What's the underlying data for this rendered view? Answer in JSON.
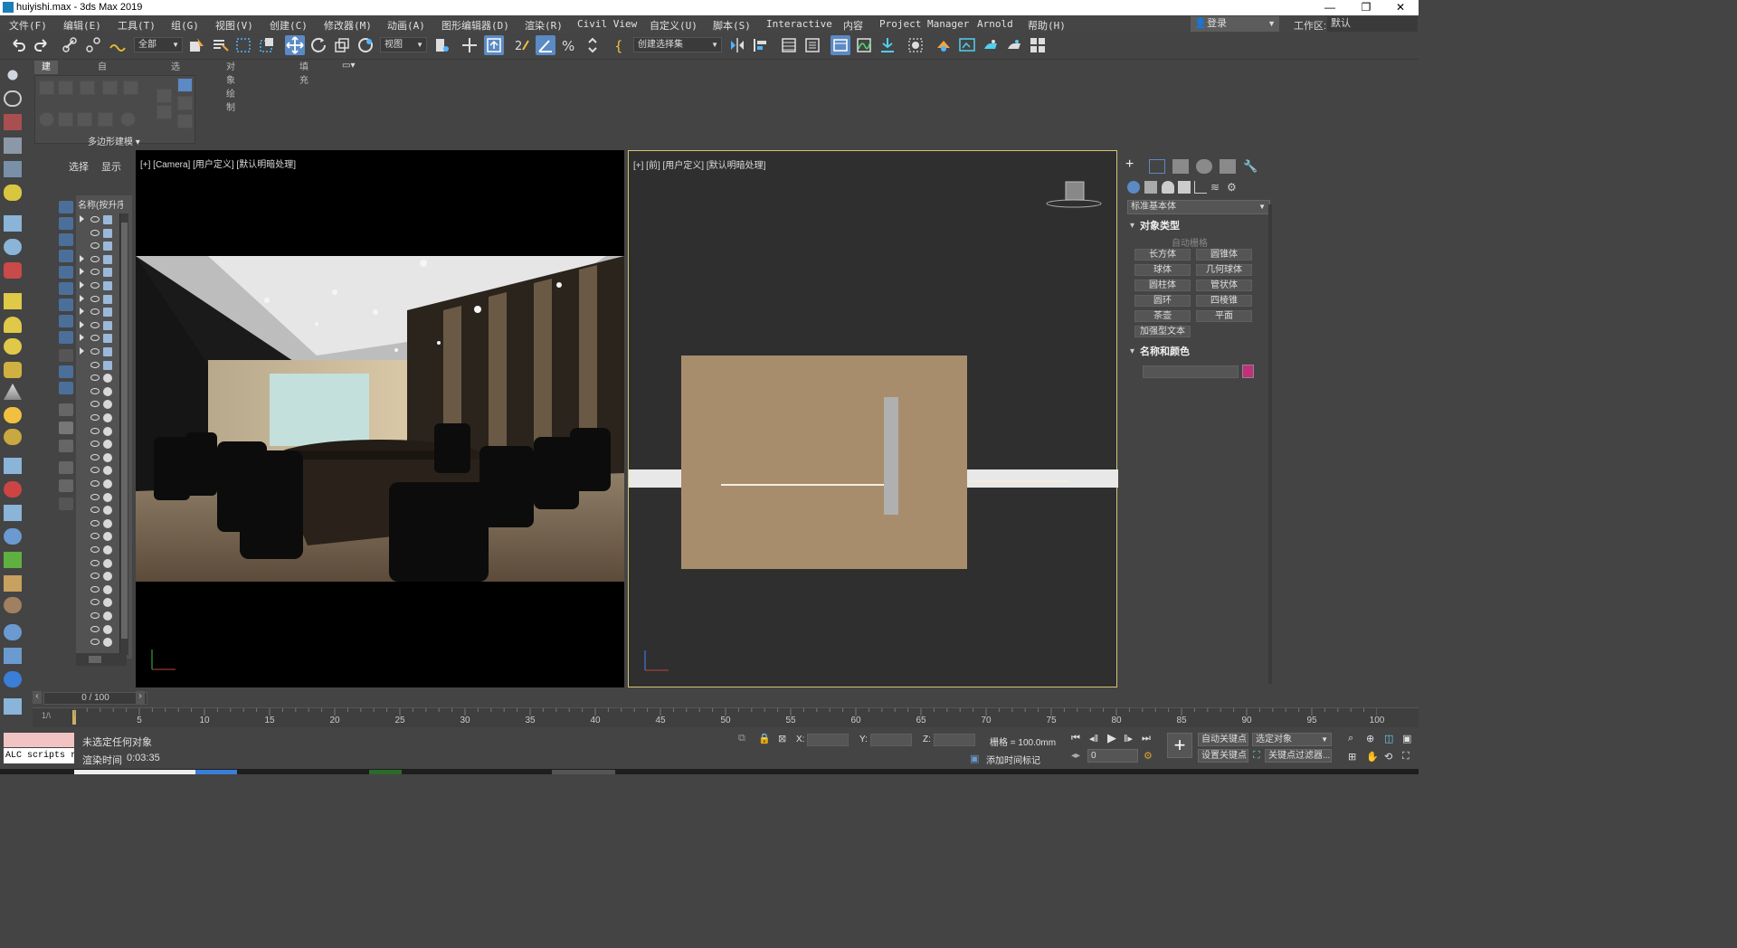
{
  "window": {
    "title": "huiyishi.max - 3ds Max 2019",
    "minimize": "—",
    "maximize": "❐",
    "close": "✕"
  },
  "menu": [
    "文件(F)",
    "编辑(E)",
    "工具(T)",
    "组(G)",
    "视图(V)",
    "创建(C)",
    "修改器(M)",
    "动画(A)",
    "图形编辑器(D)",
    "渲染(R)",
    "Civil View",
    "自定义(U)",
    "脚本(S)",
    "Interactive",
    "内容",
    "Project Manager",
    "Arnold",
    "帮助(H)"
  ],
  "account": {
    "login_label": "登录",
    "workspace_label": "工作区:",
    "workspace_value": "默认"
  },
  "toolbar": {
    "filter_value": "全部",
    "refcoord_value": "视图",
    "selection_set_placeholder": "创建选择集"
  },
  "ribbon": {
    "tabs": [
      "建模",
      "自由形式",
      "选择",
      "对象绘制",
      "填充"
    ],
    "active_tab": "建模",
    "panel_label": "多边形建模 ▾"
  },
  "explorer": {
    "tabs": [
      "选择",
      "显示"
    ],
    "column_header": "名称(按升序排序)"
  },
  "viewports": {
    "left_label": "[+] [Camera] [用户定义] [默认明暗处理]",
    "right_label": "[+] [前] [用户定义] [默认明暗处理]"
  },
  "command_panel": {
    "category_value": "标准基本体",
    "object_type_header": "对象类型",
    "autogrid_label": "自动栅格",
    "primitives": [
      "长方体",
      "圆锥体",
      "球体",
      "几何球体",
      "圆柱体",
      "管状体",
      "圆环",
      "四棱锥",
      "茶壶",
      "平面",
      "加强型文本"
    ],
    "name_color_header": "名称和颜色",
    "object_color": "#c2307d"
  },
  "timeline": {
    "frame_display": "0 / 100",
    "ticks": [
      "5",
      "10",
      "15",
      "20",
      "25",
      "30",
      "35",
      "40",
      "45",
      "50",
      "55",
      "60",
      "65",
      "70",
      "75",
      "80",
      "85",
      "90",
      "95",
      "100"
    ]
  },
  "status": {
    "maxscript_text": "ALC scripts re",
    "selection_status": "未选定任何对象",
    "render_time_label": "渲染时间",
    "render_time_value": "0:03:35",
    "x_label": "X:",
    "y_label": "Y:",
    "z_label": "Z:",
    "grid_label": "栅格 = 100.0mm",
    "add_time_tag": "添加时间标记",
    "auto_key": "自动关键点",
    "set_key": "设置关键点",
    "selected_object": "选定对象",
    "key_filters": "关键点过滤器...",
    "current_frame": "0"
  }
}
